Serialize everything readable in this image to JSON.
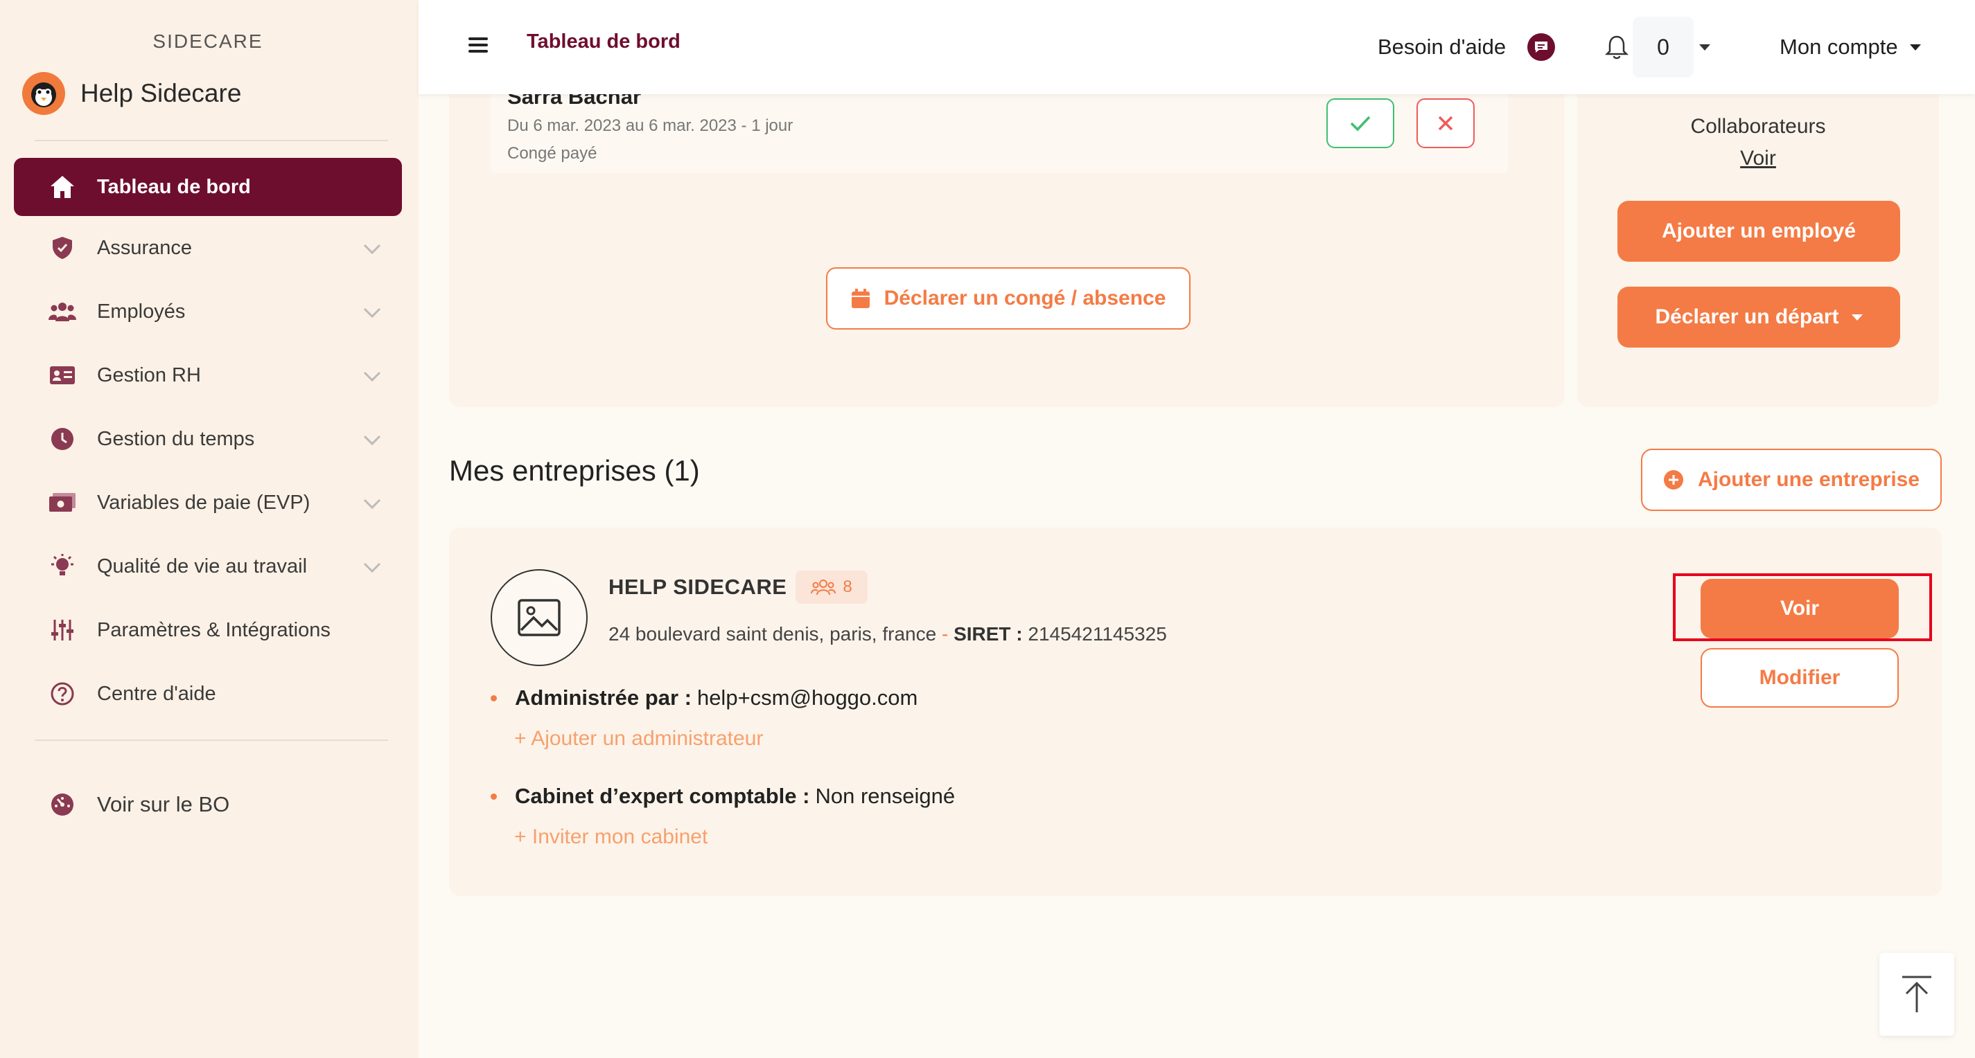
{
  "sidebar": {
    "kicker": "SIDECARE",
    "brand_name": "Help Sidecare",
    "items": [
      {
        "label": "Tableau de bord",
        "icon": "home-icon"
      },
      {
        "label": "Assurance",
        "icon": "shield-icon"
      },
      {
        "label": "Employés",
        "icon": "users-icon"
      },
      {
        "label": "Gestion RH",
        "icon": "id-card-icon"
      },
      {
        "label": "Gestion du temps",
        "icon": "clock-icon"
      },
      {
        "label": "Variables de paie (EVP)",
        "icon": "money-icon"
      },
      {
        "label": "Qualité de vie au travail",
        "icon": "lightbulb-icon"
      },
      {
        "label": "Paramètres & Intégrations",
        "icon": "sliders-icon"
      },
      {
        "label": "Centre d'aide",
        "icon": "help-circle-icon"
      }
    ],
    "bo_link": "Voir sur le BO"
  },
  "header": {
    "title": "Tableau de bord",
    "help_label": "Besoin d'aide",
    "notif_count": "0",
    "account_label": "Mon compte"
  },
  "leave_request": {
    "name": "Sarra Bachar",
    "dates": "Du 6 mar. 2023 au 6 mar. 2023 - 1 jour",
    "type": "Congé payé",
    "declare_label": "Déclarer un congé / absence"
  },
  "collaborators": {
    "label": "Collaborateurs",
    "link": "Voir",
    "add_employee": "Ajouter un employé",
    "declare_departure": "Déclarer un départ"
  },
  "companies": {
    "title": "Mes entreprises (1)",
    "add_company": "Ajouter une entreprise",
    "items": [
      {
        "name": "HELP SIDECARE",
        "employee_count": "8",
        "address": "24 boulevard saint denis, paris, france",
        "sep": " - ",
        "siret_label": "SIRET :",
        "siret": "2145421145325",
        "admin_label": "Administrée par :",
        "admin_value": "help+csm@hoggo.com",
        "add_admin": "+ Ajouter un administrateur",
        "accountant_label": "Cabinet d’expert comptable :",
        "accountant_value": "Non renseigné",
        "invite_accountant": "+ Inviter mon cabinet",
        "view_label": "Voir",
        "edit_label": "Modifier"
      }
    ]
  },
  "colors": {
    "primary": "#6e0e2f",
    "accent": "#f47b45",
    "highlight": "#e8001c"
  }
}
